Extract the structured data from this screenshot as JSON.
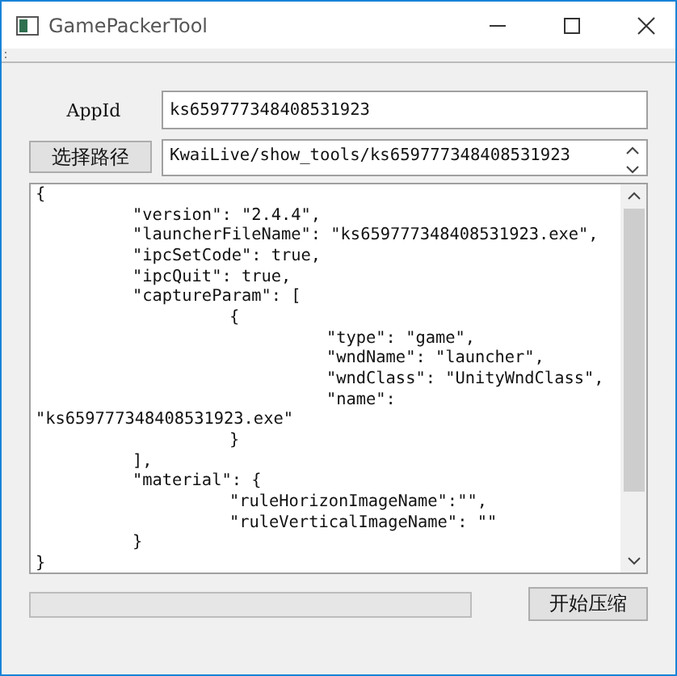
{
  "window": {
    "title": "GamePackerTool"
  },
  "app_id": {
    "label": "AppId",
    "value": "ks659777348408531923"
  },
  "path": {
    "button": "选择路径",
    "value": "KwaiLive/show_tools/ks659777348408531923"
  },
  "editor": {
    "text": "{\n\t\"version\": \"2.4.4\",\n\t\"launcherFileName\": \"ks659777348408531923.exe\",\n\t\"ipcSetCode\": true,\n\t\"ipcQuit\": true,\n\t\"captureParam\": [\n\t\t{\n\t\t\t\"type\": \"game\",\n\t\t\t\"wndName\": \"launcher\",\n\t\t\t\"wndClass\": \"UnityWndClass\",\n\t\t\t\"name\":\n\"ks659777348408531923.exe\"\n\t\t}\n\t],\n\t\"material\": {\n\t\t\"ruleHorizonImageName\":\"\",\n\t\t\"ruleVerticalImageName\": \"\"\n\t}\n}"
  },
  "progress": {
    "level": 0
  },
  "start_button": "开始压缩"
}
